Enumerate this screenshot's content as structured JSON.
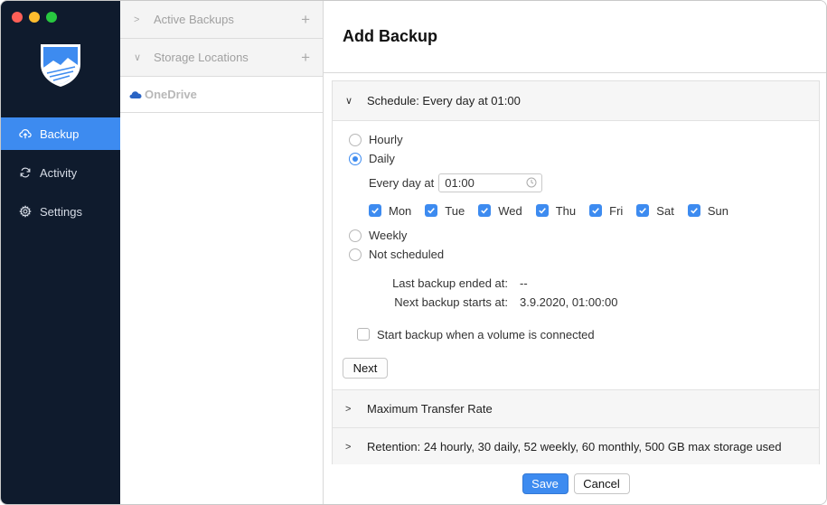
{
  "sidebar": {
    "items": [
      {
        "label": "Backup",
        "icon": "cloud-upload-icon",
        "active": true
      },
      {
        "label": "Activity",
        "icon": "refresh-icon",
        "active": false
      },
      {
        "label": "Settings",
        "icon": "gear-icon",
        "active": false
      }
    ],
    "accent": "#3d8bf0",
    "background": "#0f1b2d"
  },
  "middle": {
    "rows": [
      {
        "label": "Active Backups"
      },
      {
        "label": "Storage Locations"
      }
    ],
    "selected": {
      "label": "OneDrive",
      "icon": "onedrive-cloud-icon"
    }
  },
  "main": {
    "title": "Add Backup",
    "schedule": {
      "header": "Schedule: Every day at 01:00",
      "options": {
        "hourly": "Hourly",
        "daily": "Daily",
        "weekly": "Weekly",
        "not_scheduled": "Not scheduled"
      },
      "selected": "daily",
      "every_day_label": "Every day at",
      "time_value": "01:00",
      "days": [
        "Mon",
        "Tue",
        "Wed",
        "Thu",
        "Fri",
        "Sat",
        "Sun"
      ],
      "last_backup_label": "Last backup ended at:",
      "last_backup_value": "--",
      "next_backup_label": "Next backup starts at:",
      "next_backup_value": "3.9.2020, 01:00:00",
      "volume_label": "Start backup when a volume is connected",
      "next_button": "Next"
    },
    "transfer_rate_header": "Maximum Transfer Rate",
    "retention_header": "Retention: 24 hourly, 30 daily, 52 weekly, 60 monthly, 500 GB max storage used"
  },
  "footer": {
    "save": "Save",
    "cancel": "Cancel"
  }
}
